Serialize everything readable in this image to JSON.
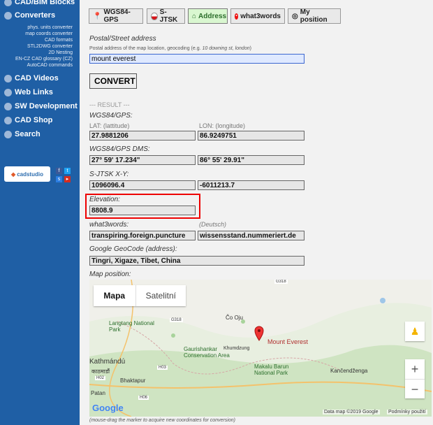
{
  "sidebar": {
    "items": [
      {
        "label": "CAD/BIM Blocks",
        "icon": "grid-icon"
      },
      {
        "label": "Converters",
        "icon": "gear-icon"
      },
      {
        "label": "CAD Videos",
        "icon": "play-icon"
      },
      {
        "label": "Web Links",
        "icon": "globe-icon"
      },
      {
        "label": "SW Development",
        "icon": "wrench-icon"
      },
      {
        "label": "CAD Shop",
        "icon": "cart-icon"
      },
      {
        "label": "Search",
        "icon": "search-icon"
      }
    ],
    "subitems": [
      "phys. units converter",
      "map coords converter",
      "CAD formats",
      "STL2DWG converter",
      "2D Nesting",
      "EN-CZ CAD glossary (CZ)",
      "AutoCAD commands"
    ],
    "logo": "cadstudio"
  },
  "tabs": [
    {
      "label": "WGS84-GPS",
      "icon": "pin-icon"
    },
    {
      "label": "S-JTSK",
      "icon": "flag-cz-icon"
    },
    {
      "label": "Address",
      "icon": "home-icon",
      "active": true
    },
    {
      "label": "what3words",
      "icon": "w3w-icon"
    },
    {
      "label": "My position",
      "icon": "target-icon"
    }
  ],
  "form": {
    "address_label": "Postal/Street address",
    "address_hint_prefix": "Postal address of the map location, geocoding (e.g.",
    "address_hint_example": "10 downing st, london",
    "address_hint_suffix": ")",
    "address_value": "mount everest",
    "convert_label": "CONVERT"
  },
  "result": {
    "separator": "--- RESULT ---",
    "wgs84_label": "WGS84/GPS:",
    "lat_label": "LAT: (lattitude)",
    "lon_label": "LON: (longitude)",
    "lat_value": "27.9881206",
    "lon_value": "86.9249751",
    "dms_label": "WGS84/GPS DMS:",
    "lat_dms": "27° 59' 17.234\"",
    "lon_dms": "86° 55' 29.91\"",
    "sjtsk_label": "S-JTSK X-Y:",
    "sjtsk_x": "1096096.4",
    "sjtsk_y": "-6011213.7",
    "elev_label": "Elevation:",
    "elev_value": "8808.9",
    "w3w_label": "what3words:",
    "w3w_lang": "(Deutsch)",
    "w3w_en": "transpiring.foreign.puncture",
    "w3w_de": "wissensstand.nummeriert.de",
    "geocode_label": "Google GeoCode (address):",
    "geocode_value": "Tingri, Xigaze, Tibet, China",
    "map_label": "Map position:"
  },
  "map": {
    "tab_map": "Mapa",
    "tab_sat": "Satelitní",
    "places": [
      "Langtang National Park",
      "Čo Oju",
      "Mount Everest",
      "Gaurishankar Conservation Area",
      "Khumdzung",
      "Kathmándú",
      "काठमाडौं",
      "Bhaktapur",
      "Makalu Barun National Park",
      "Kančendženga",
      "Patan"
    ],
    "roads": [
      "G318",
      "G318",
      "H03",
      "H02",
      "H06"
    ],
    "zoom_in": "+",
    "zoom_out": "−",
    "google_logo": "Google",
    "attribution": "Data map ©2019 Google",
    "terms": "Podmínky použití"
  },
  "footer_note": "(mouse-drag the marker to acquire new coordinates for conversion)"
}
